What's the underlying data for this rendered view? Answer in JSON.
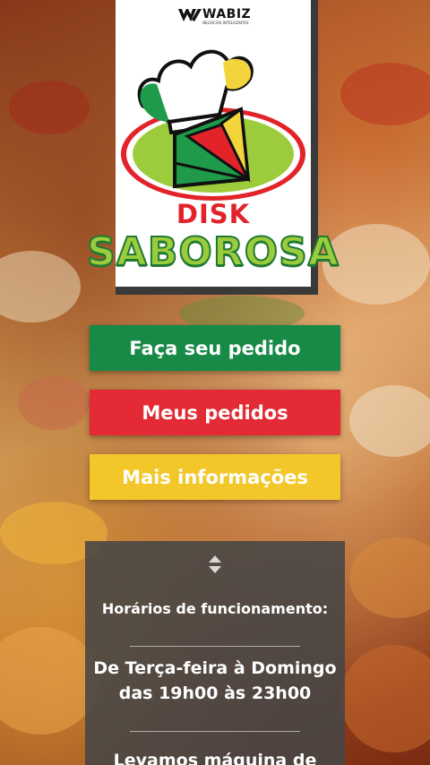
{
  "brand": {
    "partner_name": "WABIZ",
    "partner_tagline": "NEGÓCIOS INTELIGENTES",
    "name_line1": "DISK",
    "name_line2": "SABOROSA"
  },
  "colors": {
    "order_button": "#168a46",
    "my_orders_button": "#e32a35",
    "info_button": "#f3c72a",
    "panel_background": "#464646"
  },
  "actions": {
    "order_label": "Faça seu pedido",
    "my_orders_label": "Meus pedidos",
    "more_info_label": "Mais informações"
  },
  "info": {
    "toggle_icon": "chevron-up-down-icon",
    "hours_title": "Horários de funcionamento:",
    "hours_line1": "De Terça-feira à Domingo",
    "hours_line2": "das 19h00 às 23h00",
    "card_machine_partial": "Levamos máquina de"
  }
}
